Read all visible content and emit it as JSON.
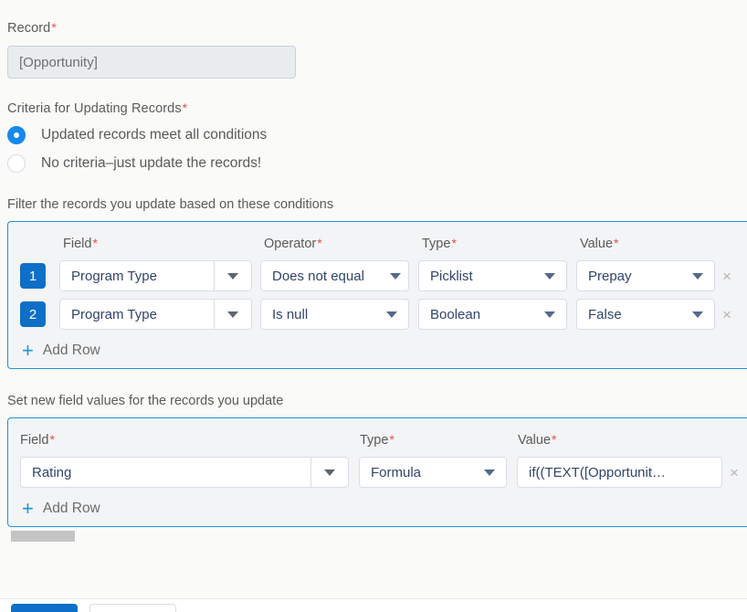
{
  "record": {
    "label": "Record",
    "required_mark": "*",
    "value": "[Opportunity]"
  },
  "criteria": {
    "label": "Criteria for Updating Records",
    "required_mark": "*",
    "options": [
      {
        "label": "Updated records meet all conditions",
        "selected": true
      },
      {
        "label": "No criteria–just update the records!",
        "selected": false
      }
    ]
  },
  "filter_section": {
    "caption": "Filter the records you update based on these conditions",
    "columns": [
      {
        "label": "Field",
        "required_mark": "*"
      },
      {
        "label": "Operator",
        "required_mark": "*"
      },
      {
        "label": "Type",
        "required_mark": "*"
      },
      {
        "label": "Value",
        "required_mark": "*"
      }
    ],
    "rows": [
      {
        "number": "1",
        "field": "Program Type",
        "operator": "Does not equal",
        "type": "Picklist",
        "value": "Prepay",
        "delete_icon": "×"
      },
      {
        "number": "2",
        "field": "Program Type",
        "operator": "Is null",
        "type": "Boolean",
        "value": "False",
        "delete_icon": "×"
      }
    ],
    "add_row": {
      "icon": "+",
      "label": "Add Row"
    }
  },
  "set_values_section": {
    "caption": "Set new field values for the records you update",
    "columns": [
      {
        "label": "Field",
        "required_mark": "*"
      },
      {
        "label": "Type",
        "required_mark": "*"
      },
      {
        "label": "Value",
        "required_mark": "*"
      }
    ],
    "rows": [
      {
        "field": "Rating",
        "type": "Formula",
        "value": "if((TEXT([Opportunit…",
        "delete_icon": "×"
      }
    ],
    "add_row": {
      "icon": "+",
      "label": "Add Row"
    }
  },
  "colors": {
    "accent_blue": "#1b96d8",
    "badge_blue": "#0d6fc7",
    "radio_blue": "#1589ee",
    "required_red": "#e0504d",
    "panel_bg": "#f3f4f6",
    "page_bg": "#fafaf9"
  }
}
